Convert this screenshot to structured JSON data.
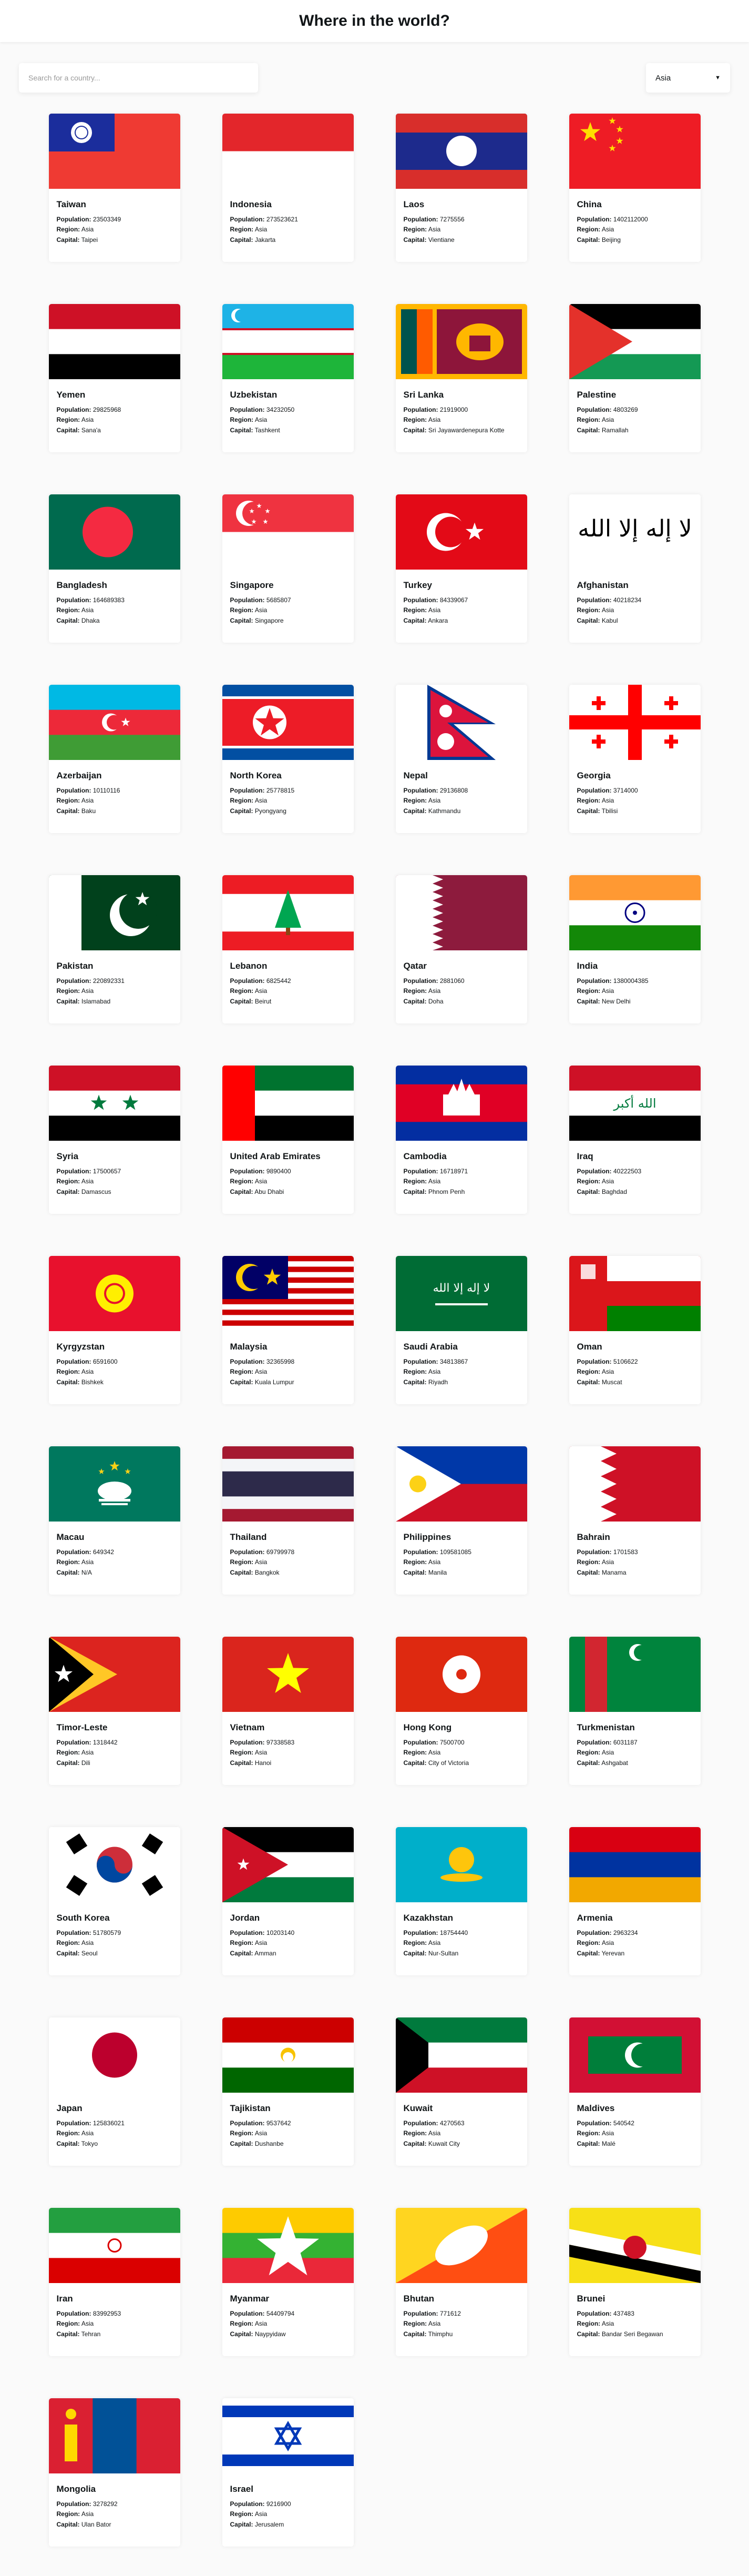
{
  "header": {
    "title": "Where in the world?"
  },
  "search": {
    "placeholder": "Search for a country..."
  },
  "filter": {
    "selected": "Asia"
  },
  "labels": {
    "population": "Population:",
    "region": "Region:",
    "capital": "Capital:"
  },
  "countries": [
    {
      "name": "Taiwan",
      "population": "23503349",
      "region": "Asia",
      "capital": "Taipei",
      "flag": "taiwan-flag"
    },
    {
      "name": "Indonesia",
      "population": "273523621",
      "region": "Asia",
      "capital": "Jakarta",
      "flag": "indonesia-flag"
    },
    {
      "name": "Laos",
      "population": "7275556",
      "region": "Asia",
      "capital": "Vientiane",
      "flag": "laos-flag"
    },
    {
      "name": "China",
      "population": "1402112000",
      "region": "Asia",
      "capital": "Beijing",
      "flag": "china-flag"
    },
    {
      "name": "Yemen",
      "population": "29825968",
      "region": "Asia",
      "capital": "Sana'a",
      "flag": "yemen-flag"
    },
    {
      "name": "Uzbekistan",
      "population": "34232050",
      "region": "Asia",
      "capital": "Tashkent",
      "flag": "uzbekistan-flag"
    },
    {
      "name": "Sri Lanka",
      "population": "21919000",
      "region": "Asia",
      "capital": "Sri Jayawardenepura Kotte",
      "flag": "sri-lanka-flag"
    },
    {
      "name": "Palestine",
      "population": "4803269",
      "region": "Asia",
      "capital": "Ramallah",
      "flag": "palestine-flag"
    },
    {
      "name": "Bangladesh",
      "population": "164689383",
      "region": "Asia",
      "capital": "Dhaka",
      "flag": "bangladesh-flag"
    },
    {
      "name": "Singapore",
      "population": "5685807",
      "region": "Asia",
      "capital": "Singapore",
      "flag": "singapore-flag"
    },
    {
      "name": "Turkey",
      "population": "84339067",
      "region": "Asia",
      "capital": "Ankara",
      "flag": "turkey-flag"
    },
    {
      "name": "Afghanistan",
      "population": "40218234",
      "region": "Asia",
      "capital": "Kabul",
      "flag": "afghanistan-flag"
    },
    {
      "name": "Azerbaijan",
      "population": "10110116",
      "region": "Asia",
      "capital": "Baku",
      "flag": "azerbaijan-flag"
    },
    {
      "name": "North Korea",
      "population": "25778815",
      "region": "Asia",
      "capital": "Pyongyang",
      "flag": "north-korea-flag"
    },
    {
      "name": "Nepal",
      "population": "29136808",
      "region": "Asia",
      "capital": "Kathmandu",
      "flag": "nepal-flag"
    },
    {
      "name": "Georgia",
      "population": "3714000",
      "region": "Asia",
      "capital": "Tbilisi",
      "flag": "georgia-flag"
    },
    {
      "name": "Pakistan",
      "population": "220892331",
      "region": "Asia",
      "capital": "Islamabad",
      "flag": "pakistan-flag"
    },
    {
      "name": "Lebanon",
      "population": "6825442",
      "region": "Asia",
      "capital": "Beirut",
      "flag": "lebanon-flag"
    },
    {
      "name": "Qatar",
      "population": "2881060",
      "region": "Asia",
      "capital": "Doha",
      "flag": "qatar-flag"
    },
    {
      "name": "India",
      "population": "1380004385",
      "region": "Asia",
      "capital": "New Delhi",
      "flag": "india-flag"
    },
    {
      "name": "Syria",
      "population": "17500657",
      "region": "Asia",
      "capital": "Damascus",
      "flag": "syria-flag"
    },
    {
      "name": "United Arab Emirates",
      "population": "9890400",
      "region": "Asia",
      "capital": "Abu Dhabi",
      "flag": "uae-flag"
    },
    {
      "name": "Cambodia",
      "population": "16718971",
      "region": "Asia",
      "capital": "Phnom Penh",
      "flag": "cambodia-flag"
    },
    {
      "name": "Iraq",
      "population": "40222503",
      "region": "Asia",
      "capital": "Baghdad",
      "flag": "iraq-flag"
    },
    {
      "name": "Kyrgyzstan",
      "population": "6591600",
      "region": "Asia",
      "capital": "Bishkek",
      "flag": "kyrgyzstan-flag"
    },
    {
      "name": "Malaysia",
      "population": "32365998",
      "region": "Asia",
      "capital": "Kuala Lumpur",
      "flag": "malaysia-flag"
    },
    {
      "name": "Saudi Arabia",
      "population": "34813867",
      "region": "Asia",
      "capital": "Riyadh",
      "flag": "saudi-arabia-flag"
    },
    {
      "name": "Oman",
      "population": "5106622",
      "region": "Asia",
      "capital": "Muscat",
      "flag": "oman-flag"
    },
    {
      "name": "Macau",
      "population": "649342",
      "region": "Asia",
      "capital": "N/A",
      "flag": "macau-flag"
    },
    {
      "name": "Thailand",
      "population": "69799978",
      "region": "Asia",
      "capital": "Bangkok",
      "flag": "thailand-flag"
    },
    {
      "name": "Philippines",
      "population": "109581085",
      "region": "Asia",
      "capital": "Manila",
      "flag": "philippines-flag"
    },
    {
      "name": "Bahrain",
      "population": "1701583",
      "region": "Asia",
      "capital": "Manama",
      "flag": "bahrain-flag"
    },
    {
      "name": "Timor-Leste",
      "population": "1318442",
      "region": "Asia",
      "capital": "Dili",
      "flag": "timor-leste-flag"
    },
    {
      "name": "Vietnam",
      "population": "97338583",
      "region": "Asia",
      "capital": "Hanoi",
      "flag": "vietnam-flag"
    },
    {
      "name": "Hong Kong",
      "population": "7500700",
      "region": "Asia",
      "capital": "City of Victoria",
      "flag": "hong-kong-flag"
    },
    {
      "name": "Turkmenistan",
      "population": "6031187",
      "region": "Asia",
      "capital": "Ashgabat",
      "flag": "turkmenistan-flag"
    },
    {
      "name": "South Korea",
      "population": "51780579",
      "region": "Asia",
      "capital": "Seoul",
      "flag": "south-korea-flag"
    },
    {
      "name": "Jordan",
      "population": "10203140",
      "region": "Asia",
      "capital": "Amman",
      "flag": "jordan-flag"
    },
    {
      "name": "Kazakhstan",
      "population": "18754440",
      "region": "Asia",
      "capital": "Nur-Sultan",
      "flag": "kazakhstan-flag"
    },
    {
      "name": "Armenia",
      "population": "2963234",
      "region": "Asia",
      "capital": "Yerevan",
      "flag": "armenia-flag"
    },
    {
      "name": "Japan",
      "population": "125836021",
      "region": "Asia",
      "capital": "Tokyo",
      "flag": "japan-flag"
    },
    {
      "name": "Tajikistan",
      "population": "9537642",
      "region": "Asia",
      "capital": "Dushanbe",
      "flag": "tajikistan-flag"
    },
    {
      "name": "Kuwait",
      "population": "4270563",
      "region": "Asia",
      "capital": "Kuwait City",
      "flag": "kuwait-flag"
    },
    {
      "name": "Maldives",
      "population": "540542",
      "region": "Asia",
      "capital": "Malé",
      "flag": "maldives-flag"
    },
    {
      "name": "Iran",
      "population": "83992953",
      "region": "Asia",
      "capital": "Tehran",
      "flag": "iran-flag"
    },
    {
      "name": "Myanmar",
      "population": "54409794",
      "region": "Asia",
      "capital": "Naypyidaw",
      "flag": "myanmar-flag"
    },
    {
      "name": "Bhutan",
      "population": "771612",
      "region": "Asia",
      "capital": "Thimphu",
      "flag": "bhutan-flag"
    },
    {
      "name": "Brunei",
      "population": "437483",
      "region": "Asia",
      "capital": "Bandar Seri Begawan",
      "flag": "brunei-flag"
    },
    {
      "name": "Mongolia",
      "population": "3278292",
      "region": "Asia",
      "capital": "Ulan Bator",
      "flag": "mongolia-flag"
    },
    {
      "name": "Israel",
      "population": "9216900",
      "region": "Asia",
      "capital": "Jerusalem",
      "flag": "israel-flag"
    }
  ]
}
